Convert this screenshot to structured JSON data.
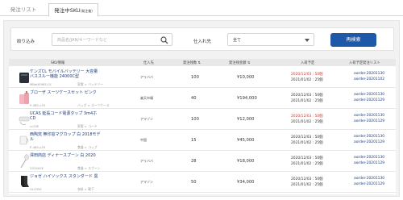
{
  "tabs": [
    {
      "label": "発注リスト",
      "sub": ""
    },
    {
      "label": "発注中SKU",
      "sub": "(発注後)"
    }
  ],
  "filter": {
    "label": "絞り込み",
    "search_placeholder": "商品名/JAN/キーワードなど",
    "supplier_label": "仕入れ先",
    "supplier_value": "全て",
    "research_button": "再検索"
  },
  "table": {
    "headers": [
      "SKU情報",
      "仕入先",
      "発注残数 ⇅",
      "発注残金額 ⇅",
      "入荷予定",
      "入荷予定発注リスト"
    ],
    "rows": [
      {
        "name": "ケンズCL モバイルバッテリー 大容量 バススルー機能 24000C型",
        "code": "MBatt5985-01",
        "category": "家電 > バッテリー",
        "supplier": "アリババ",
        "count": "100",
        "amount": "¥10,000",
        "date1": "2020/12/03 : 50個",
        "date2": "2021/01/02 : 25個",
        "date1_red": true,
        "order1": "aorder-20201130",
        "order2": "aorder-20201102",
        "thumb": "battery"
      },
      {
        "name": "ブローザ スーツケースセット ピンク",
        "code": "P-485-c35",
        "category": "バッグ > スーツケース",
        "supplier": "楽天市場",
        "count": "40",
        "amount": "¥194,000",
        "date1": "2020/12/03 : 50個",
        "date2": "2021/01/02 : 25個",
        "date1_red": false,
        "order1": "aorder-20201130",
        "order2": "aorder-20201129",
        "thumb": "suitcase"
      },
      {
        "name": "UCAS 延長コード電源タップ 3m4ホCD",
        "code": "cc25E",
        "category": "家電 > コード",
        "supplier": "アマゾン",
        "count": "100",
        "amount": "¥12,000",
        "date1": "2020/12/03 : 50個",
        "date2": "2021/01/02 : 25個",
        "date1_red": true,
        "order1": "aorder-20201130",
        "order2": "aorder-20201129",
        "thumb": "cable"
      },
      {
        "name": "西陶窯 無印窓マグカップ 白 2018モデル",
        "code": "P-485-c35",
        "category": "食器 > コップ",
        "supplier": "中国",
        "count": "15",
        "amount": "¥45,000",
        "date1": "2020/12/03 : 50個",
        "date2": "2021/01/02 : 25個",
        "date1_red": false,
        "order1": "aorder-20201130",
        "order2": "aorder-20201129",
        "thumb": "mug"
      },
      {
        "name": "澤田商店 ディナースプーン 白 2020",
        "code": "2525A5E",
        "category": "食器 > スプーン",
        "supplier": "アリババ",
        "count": "28",
        "amount": "¥18,000",
        "date1": "2020/12/03 : 50個",
        "date2": "2021/01/02 : 25個",
        "date1_red": false,
        "order1": "aorder-20201130",
        "order2": "aorder-20201129",
        "thumb": "spoon"
      },
      {
        "name": "ジョゼ ハイソックス スタンダード 黒",
        "code": "GL3355",
        "category": "衣料 > 靴下",
        "supplier": "アマゾン",
        "count": "50",
        "amount": "¥34,000",
        "date1": "2020/12/03 : 50個",
        "date2": "2021/01/02 : 25個",
        "date1_red": false,
        "order1": "aorder-20201130",
        "order2": "aorder-20201129",
        "thumb": "socks"
      }
    ]
  }
}
